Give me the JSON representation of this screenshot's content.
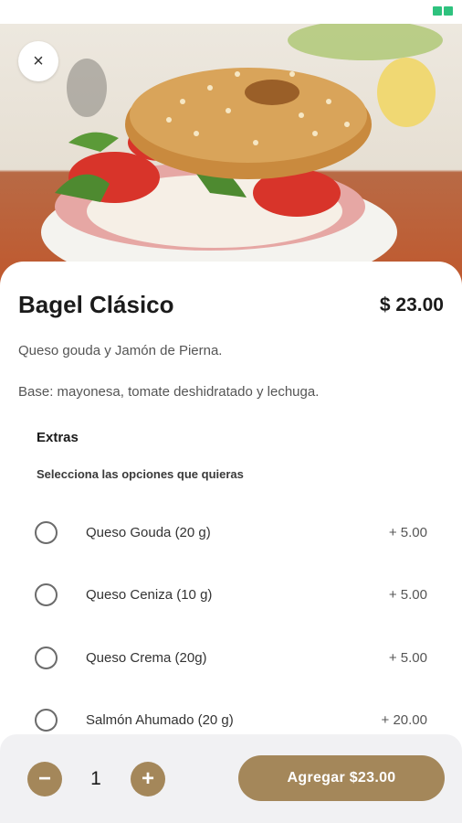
{
  "status_bar": {
    "icons": [
      "status-icon",
      "battery-icon"
    ]
  },
  "header": {
    "close_icon": "×"
  },
  "product": {
    "title": "Bagel Clásico",
    "price": "$ 23.00",
    "description": "Queso gouda y Jamón de Pierna.",
    "base": "Base: mayonesa, tomate deshidratado y lechuga."
  },
  "extras": {
    "title": "Extras",
    "subtitle": "Selecciona las opciones que quieras",
    "options": [
      {
        "label": "Queso Gouda (20 g)",
        "price": "+ 5.00"
      },
      {
        "label": "Queso Ceniza (10 g)",
        "price": "+ 5.00"
      },
      {
        "label": "Queso Crema (20g)",
        "price": "+ 5.00"
      },
      {
        "label": "Salmón Ahumado (20 g)",
        "price": "+ 20.00"
      }
    ]
  },
  "cart": {
    "minus": "−",
    "plus": "+",
    "quantity": "1",
    "add_label": "Agregar $23.00"
  },
  "colors": {
    "accent": "#a4875a",
    "bottom_bar": "#f1f1f3"
  }
}
